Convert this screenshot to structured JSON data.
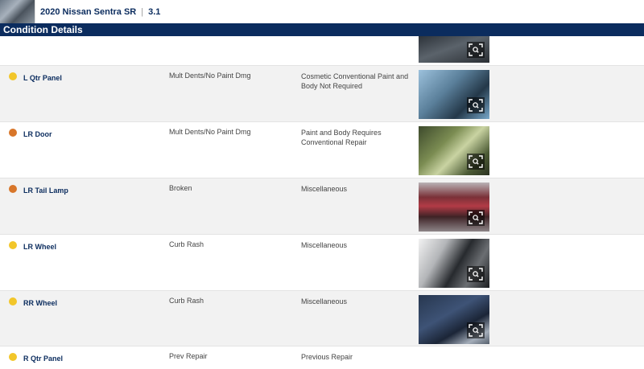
{
  "header": {
    "vehicle_title": "2020 Nissan Sentra SR",
    "separator": "|",
    "grade": "3.1"
  },
  "section": {
    "title": "Condition Details"
  },
  "rows": [
    {
      "part": "L Qtr Panel",
      "damage": "Mult Dents/No Paint Dmg",
      "action": "Cosmetic Conventional Paint and Body Not Required",
      "severity": "yellow"
    },
    {
      "part": "LR Door",
      "damage": "Mult Dents/No Paint Dmg",
      "action": "Paint and Body Requires Conventional Repair",
      "severity": "orange"
    },
    {
      "part": "LR Tail Lamp",
      "damage": "Broken",
      "action": "Miscellaneous",
      "severity": "orange"
    },
    {
      "part": "LR Wheel",
      "damage": "Curb Rash",
      "action": "Miscellaneous",
      "severity": "yellow"
    },
    {
      "part": "RR Wheel",
      "damage": "Curb Rash",
      "action": "Miscellaneous",
      "severity": "yellow"
    },
    {
      "part": "R Qtr Panel",
      "damage": "Prev Repair",
      "action": "Previous Repair",
      "severity": "yellow"
    }
  ],
  "colors": {
    "brand_navy": "#0b2c5e",
    "severity_yellow": "#f2c62a",
    "severity_orange": "#d8762a"
  },
  "icons": {
    "expand": "expand-magnify-icon"
  }
}
